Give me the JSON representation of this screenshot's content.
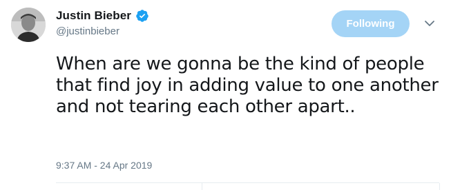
{
  "tweet": {
    "author": {
      "display_name": "Justin Bieber",
      "handle": "@justinbieber",
      "verified": true,
      "avatar_icon": "user-avatar"
    },
    "follow_button": {
      "label": "Following"
    },
    "more_menu_icon": "chevron-down-icon",
    "text": "When are we gonna be the kind of people that find joy in adding value to one another and not tearing each other apart..",
    "timestamp": "9:37 AM - 24 Apr 2019"
  },
  "colors": {
    "text": "#14171a",
    "secondary": "#657786",
    "following_button_bg": "#a4d4f6",
    "verified_badge": "#1da1f2",
    "divider": "#e6ecf0"
  }
}
